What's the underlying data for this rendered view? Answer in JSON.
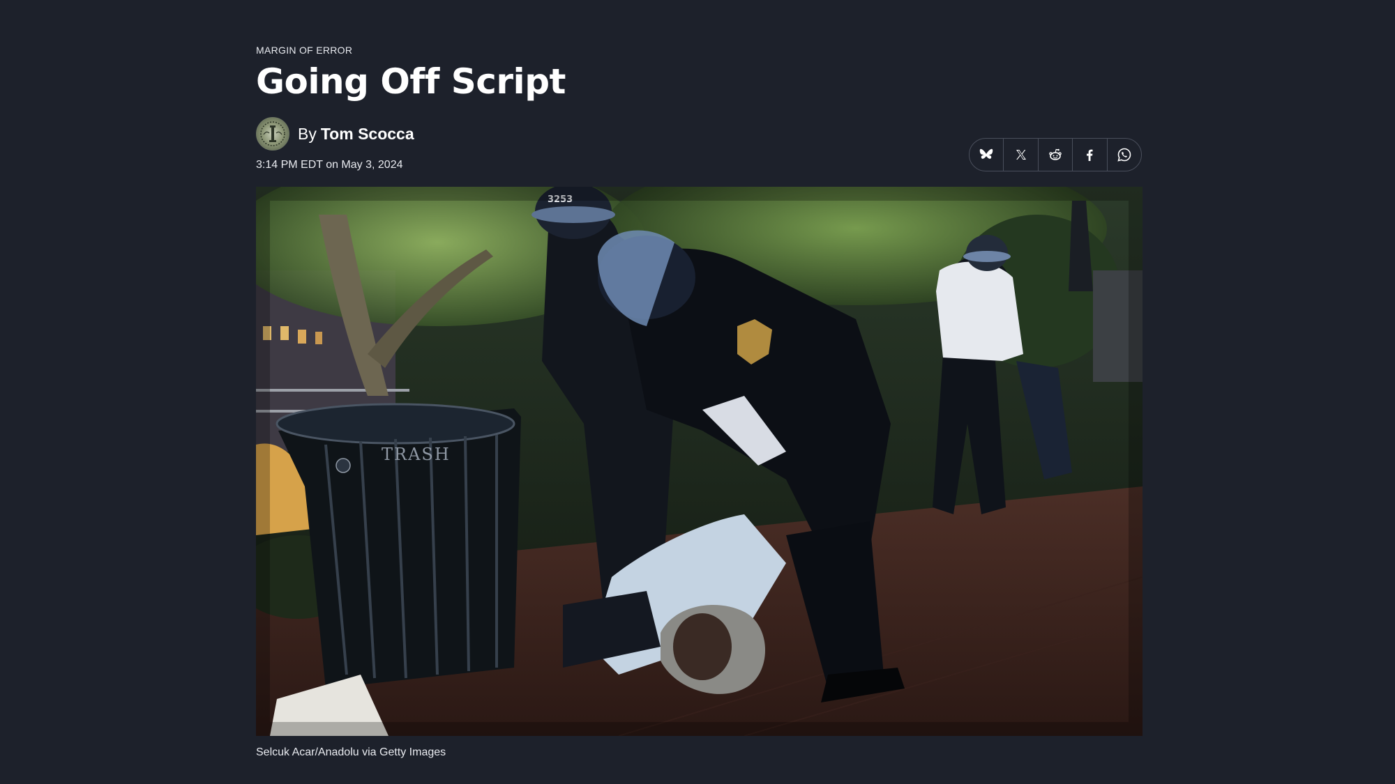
{
  "article": {
    "kicker": "MARGIN OF ERROR",
    "title": "Going Off Script",
    "byline_prefix": "By",
    "author": "Tom Scocca",
    "timestamp": "3:14 PM EDT on May 3, 2024",
    "caption": "Selcuk Acar/Anadolu via Getty Images"
  },
  "share": {
    "buttons": [
      {
        "name": "bluesky",
        "icon": "butterfly-icon"
      },
      {
        "name": "x",
        "icon": "x-logo-icon"
      },
      {
        "name": "reddit",
        "icon": "reddit-icon"
      },
      {
        "name": "facebook",
        "icon": "facebook-icon"
      },
      {
        "name": "whatsapp",
        "icon": "whatsapp-icon"
      }
    ]
  },
  "photo": {
    "helmet_number": "3253",
    "trash_label": "TRASH"
  },
  "colors": {
    "background": "#1d212b",
    "text": "#ffffff",
    "muted_text": "#e9ebf0",
    "share_border": "#4a4f5c"
  }
}
